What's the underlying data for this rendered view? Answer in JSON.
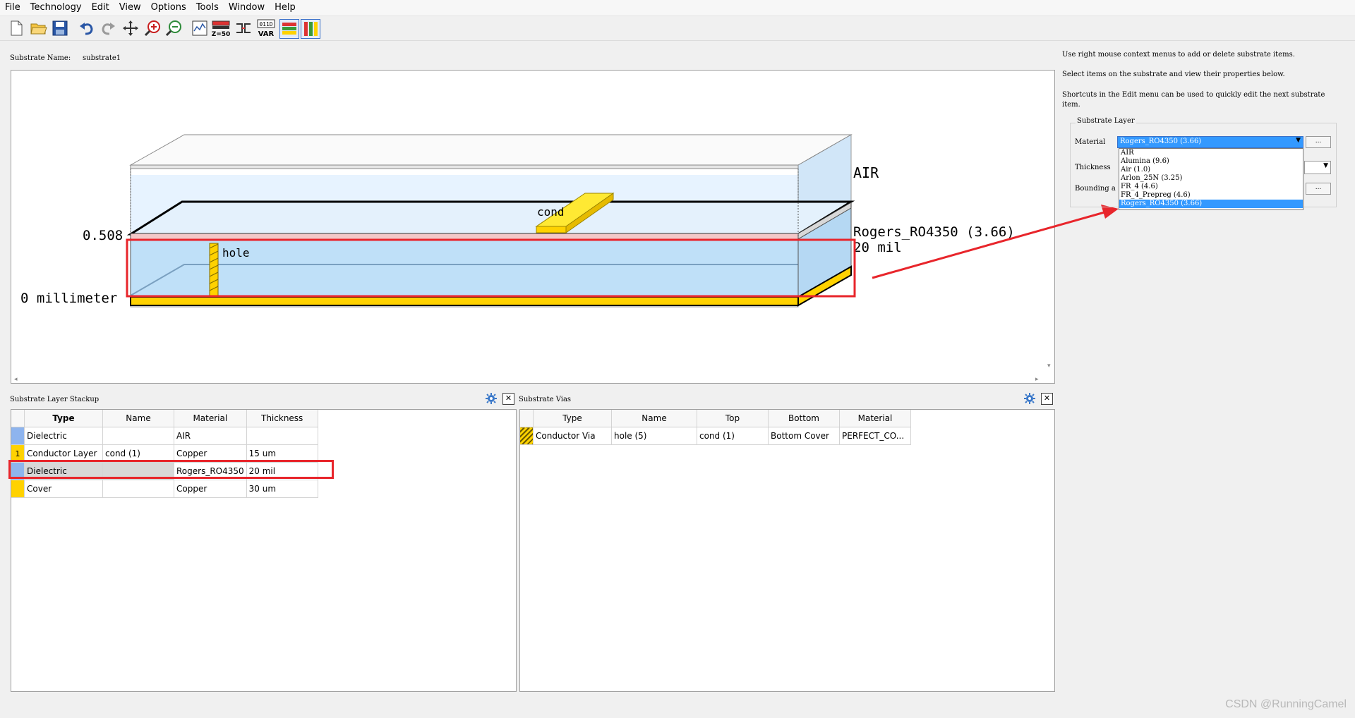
{
  "menu": [
    "File",
    "Technology",
    "Edit",
    "View",
    "Options",
    "Tools",
    "Window",
    "Help"
  ],
  "toolbar": {
    "icons": [
      "new-file-icon",
      "open-folder-icon",
      "save-icon",
      "undo-icon",
      "redo-icon",
      "pan-icon",
      "zoom-in-icon",
      "zoom-out-icon",
      "plot-icon",
      "z50-icon",
      "port-icon",
      "var-icon",
      "layer-view-icon",
      "via-view-icon"
    ],
    "z50_text": "Z=50",
    "var_text_top": "011D",
    "var_text_bottom": "VAR"
  },
  "substrate_name_label": "Substrate Name:",
  "substrate_name_value": "substrate1",
  "diagram": {
    "air_label": "AIR",
    "cond_label": "cond",
    "hole_label": "hole",
    "height_label": "0.508",
    "zero_label": "0 millimeter",
    "material_label": "Rogers_RO4350 (3.66)",
    "thickness_label": "20 mil"
  },
  "help": {
    "line1": "Use right mouse context menus to add or delete substrate items.",
    "line2": "Select items on the substrate and view their properties below.",
    "line3": "Shortcuts in the Edit menu can be used to quickly edit the next substrate item."
  },
  "substrate_layer": {
    "group_title": "Substrate Layer",
    "material_label": "Material",
    "material_value": "Rogers_RO4350 (3.66)",
    "thickness_label": "Thickness",
    "bounding_label": "Bounding a",
    "ellipsis": "...",
    "options": [
      "AIR",
      "Alumina (9.6)",
      "Air (1.0)",
      "Arlon_25N (3.25)",
      "FR_4 (4.6)",
      "FR_4_Prepreg (4.6)",
      "Rogers_RO4350 (3.66)"
    ],
    "selected_index": 6
  },
  "stackup": {
    "title": "Substrate Layer Stackup",
    "columns": [
      "Type",
      "Name",
      "Material",
      "Thickness"
    ],
    "rows": [
      {
        "marker": "",
        "color": "#8eb4ee",
        "type": "Dielectric",
        "name": "",
        "material": "AIR",
        "thickness": ""
      },
      {
        "marker": "1",
        "color": "#ffd200",
        "type": "Conductor Layer",
        "name": "cond (1)",
        "material": "Copper",
        "thickness": "15 um"
      },
      {
        "marker": "",
        "color": "#8eb4ee",
        "type": "Dielectric",
        "name": "",
        "material": "Rogers_RO4350",
        "thickness": "20 mil"
      },
      {
        "marker": "",
        "color": "#ffd200",
        "type": "Cover",
        "name": "",
        "material": "Copper",
        "thickness": "30 um"
      }
    ]
  },
  "vias": {
    "title": "Substrate Vias",
    "columns": [
      "Type",
      "Name",
      "Top",
      "Bottom",
      "Material"
    ],
    "rows": [
      {
        "type": "Conductor Via",
        "name": "hole (5)",
        "top": "cond (1)",
        "bottom": "Bottom Cover",
        "material": "PERFECT_CO..."
      }
    ]
  },
  "watermark": "CSDN @RunningCamel",
  "colors": {
    "highlight": "#e8252b",
    "selection": "#3399ff",
    "copper": "#ffd200",
    "dielectric": "#bfe0f8"
  }
}
